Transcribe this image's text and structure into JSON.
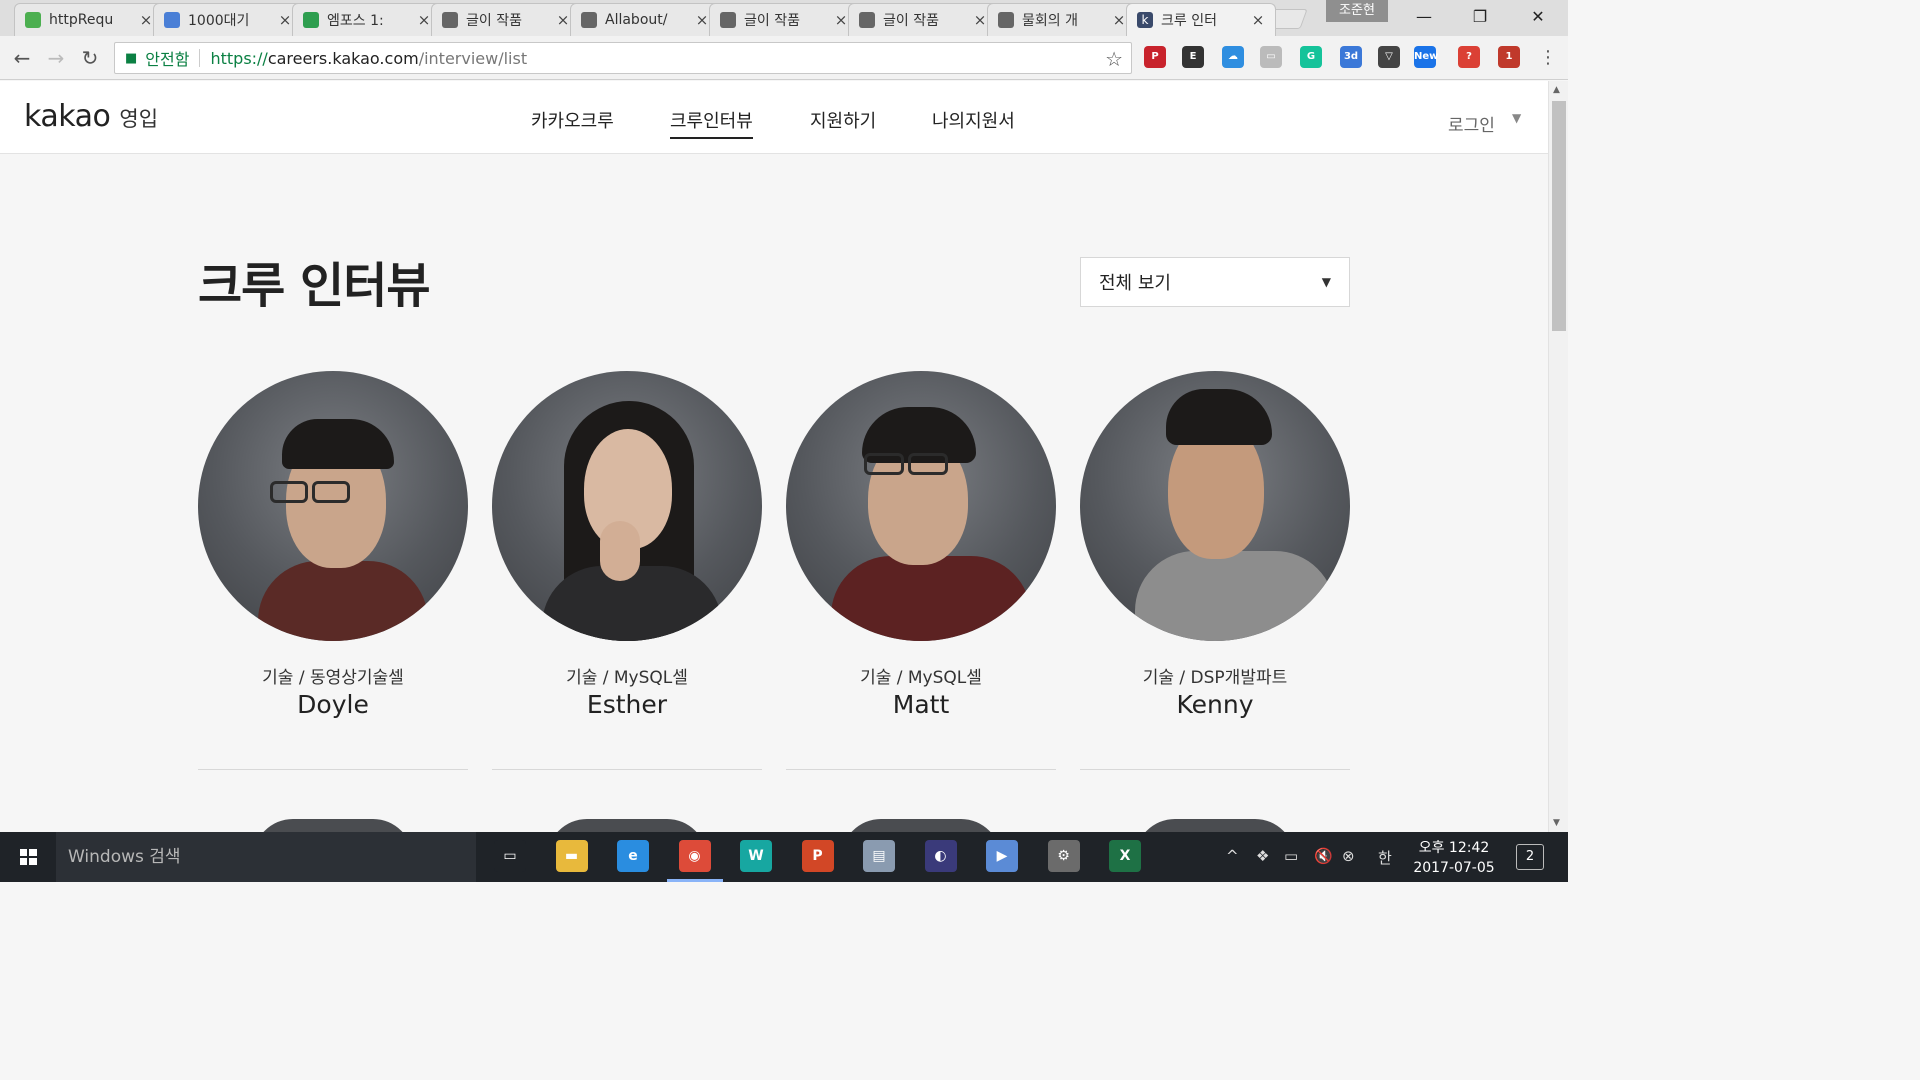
{
  "browser": {
    "tabs": [
      {
        "label": "httpRequ",
        "favicon_color": "#4caf50",
        "active": false
      },
      {
        "label": "1000대기",
        "favicon_color": "#4a7fd6",
        "active": false
      },
      {
        "label": "엠포스 1:",
        "favicon_color": "#2e9e4f",
        "active": false
      },
      {
        "label": "글이 작품",
        "favicon_color": "#666666",
        "active": false
      },
      {
        "label": "Allabout/",
        "favicon_color": "#666666",
        "active": false
      },
      {
        "label": "글이 작품",
        "favicon_color": "#666666",
        "active": false
      },
      {
        "label": "글이 작품",
        "favicon_color": "#666666",
        "active": false
      },
      {
        "label": "물회의 개",
        "favicon_color": "#666666",
        "active": false
      },
      {
        "label": "크루 인터",
        "favicon_color": "#3a4a6b",
        "favicon_text": "k",
        "active": true
      }
    ],
    "tab_close": "×",
    "profile_name": "조준현",
    "window_controls": {
      "minimize": "—",
      "restore": "❐",
      "close": "✕"
    },
    "secure_label": "안전함",
    "url": {
      "scheme": "https://",
      "host": "careers.kakao.com",
      "path": "/interview/list"
    },
    "extensions": [
      {
        "name": "pinterest-icon",
        "color": "#c8232c",
        "label": "P"
      },
      {
        "name": "evernote-icon",
        "color": "#333333",
        "label": "E"
      },
      {
        "name": "onedrive-icon",
        "color": "#2f8ee0",
        "label": "☁"
      },
      {
        "name": "reader-icon",
        "color": "#bbbbbb",
        "label": "▭"
      },
      {
        "name": "grammarly-icon",
        "color": "#15c39a",
        "label": "G"
      },
      {
        "name": "3d-ext-icon",
        "color": "#3b78d8",
        "label": "3d"
      },
      {
        "name": "pocket-icon",
        "color": "#444444",
        "label": "▽"
      },
      {
        "name": "news-ext-icon",
        "color": "#1a73e8",
        "label": "New"
      },
      {
        "name": "todoist-icon",
        "color": "#db4035",
        "label": "?"
      },
      {
        "name": "adblock-icon",
        "color": "#c0392b",
        "label": "1"
      }
    ]
  },
  "site": {
    "logo_main": "kakao",
    "logo_sub": "영입",
    "nav": [
      {
        "label": "카카오크루",
        "active": false
      },
      {
        "label": "크루인터뷰",
        "active": true
      },
      {
        "label": "지원하기",
        "active": false
      },
      {
        "label": "나의지원서",
        "active": false
      }
    ],
    "login_label": "로그인"
  },
  "main": {
    "title": "크루 인터뷰",
    "filter": {
      "selected": "전체 보기"
    },
    "crew": [
      {
        "dept": "기술 / 동영상기술셀",
        "name": "Doyle",
        "shirt": "#5a2a26",
        "glasses": true
      },
      {
        "dept": "기술 / MySQL셀",
        "name": "Esther",
        "shirt": "#2a2a2c",
        "glasses": false
      },
      {
        "dept": "기술 / MySQL셀",
        "name": "Matt",
        "shirt": "#5c2222",
        "glasses": true
      },
      {
        "dept": "기술 / DSP개발파트",
        "name": "Kenny",
        "shirt": "#8d8d8d",
        "glasses": false
      }
    ]
  },
  "taskbar": {
    "search_placeholder": "Windows 검색",
    "apps": [
      {
        "name": "task-view-icon",
        "color": "#1f2328",
        "label": "▭"
      },
      {
        "name": "file-explorer-icon",
        "color": "#e8b93c",
        "label": "▬"
      },
      {
        "name": "internet-explorer-icon",
        "color": "#2a8de0",
        "label": "e"
      },
      {
        "name": "chrome-icon",
        "color": "#dd4b39",
        "label": "◉"
      },
      {
        "name": "app-w-icon",
        "color": "#17a7a1",
        "label": "W"
      },
      {
        "name": "powerpoint-icon",
        "color": "#d24726",
        "label": "P"
      },
      {
        "name": "db-app-icon",
        "color": "#8a9bb0",
        "label": "▤"
      },
      {
        "name": "eclipse-icon",
        "color": "#3a3a7a",
        "label": "◐"
      },
      {
        "name": "media-app-icon",
        "color": "#5b8bd6",
        "label": "▶"
      },
      {
        "name": "settings-app-icon",
        "color": "#6b6b6b",
        "label": "⚙"
      },
      {
        "name": "excel-icon",
        "color": "#1e7145",
        "label": "X"
      }
    ],
    "ime": "한",
    "clock_period": "오후 12:42",
    "clock_date": "2017-07-05",
    "notification_count": "2"
  }
}
